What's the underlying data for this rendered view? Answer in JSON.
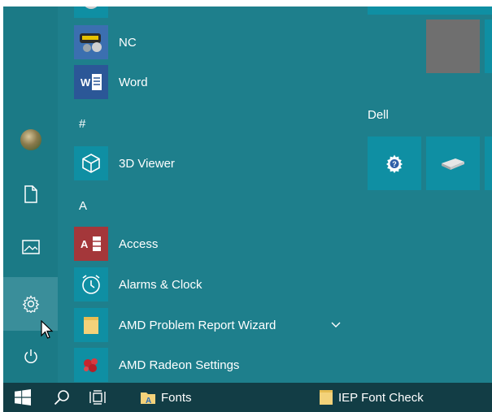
{
  "start_menu": {
    "rail": {
      "items": [
        {
          "name": "user-avatar",
          "icon": "avatar-icon"
        },
        {
          "name": "documents",
          "icon": "document-icon"
        },
        {
          "name": "pictures",
          "icon": "pictures-icon"
        },
        {
          "name": "settings",
          "icon": "gear-icon"
        },
        {
          "name": "power",
          "icon": "power-icon"
        }
      ]
    },
    "app_list": {
      "items": [
        {
          "type": "app",
          "label": "NC",
          "icon": "nc-app-icon",
          "tile_color": "#3b6fb0"
        },
        {
          "type": "app",
          "label": "Word",
          "icon": "word-icon",
          "tile_color": "#2b5797"
        },
        {
          "type": "header",
          "label": "#"
        },
        {
          "type": "app",
          "label": "3D Viewer",
          "icon": "cube-icon",
          "tile_color": "#0f8fa3"
        },
        {
          "type": "header",
          "label": "A"
        },
        {
          "type": "app",
          "label": "Access",
          "icon": "access-icon",
          "tile_color": "#a4373a"
        },
        {
          "type": "app",
          "label": "Alarms & Clock",
          "icon": "clock-icon",
          "tile_color": "#0f8fa3"
        },
        {
          "type": "app",
          "label": "AMD Problem Report Wizard",
          "icon": "folder-icon",
          "tile_color": "#0f8fa3",
          "expandable": true
        },
        {
          "type": "app",
          "label": "AMD Radeon Settings",
          "icon": "radeon-icon",
          "tile_color": "#0f8fa3"
        }
      ]
    },
    "tiles": {
      "group_label": "Dell",
      "dell_tiles": [
        {
          "icon": "dell-help-icon"
        },
        {
          "icon": "drive-icon"
        }
      ]
    }
  },
  "taskbar": {
    "items": [
      {
        "label": "",
        "icon": "windows-logo-icon"
      },
      {
        "label": "",
        "icon": "search-icon"
      },
      {
        "label": "",
        "icon": "task-view-icon"
      },
      {
        "label": "Fonts",
        "icon": "folder-icon"
      },
      {
        "label": "IEP Font Check",
        "icon": "document-icon"
      }
    ]
  },
  "colors": {
    "start_bg": "#1e7f8c",
    "rail_bg": "#1b7a86",
    "hover": "#3a8e9a",
    "tile": "#0f8fa3",
    "taskbar": "#123d45"
  }
}
